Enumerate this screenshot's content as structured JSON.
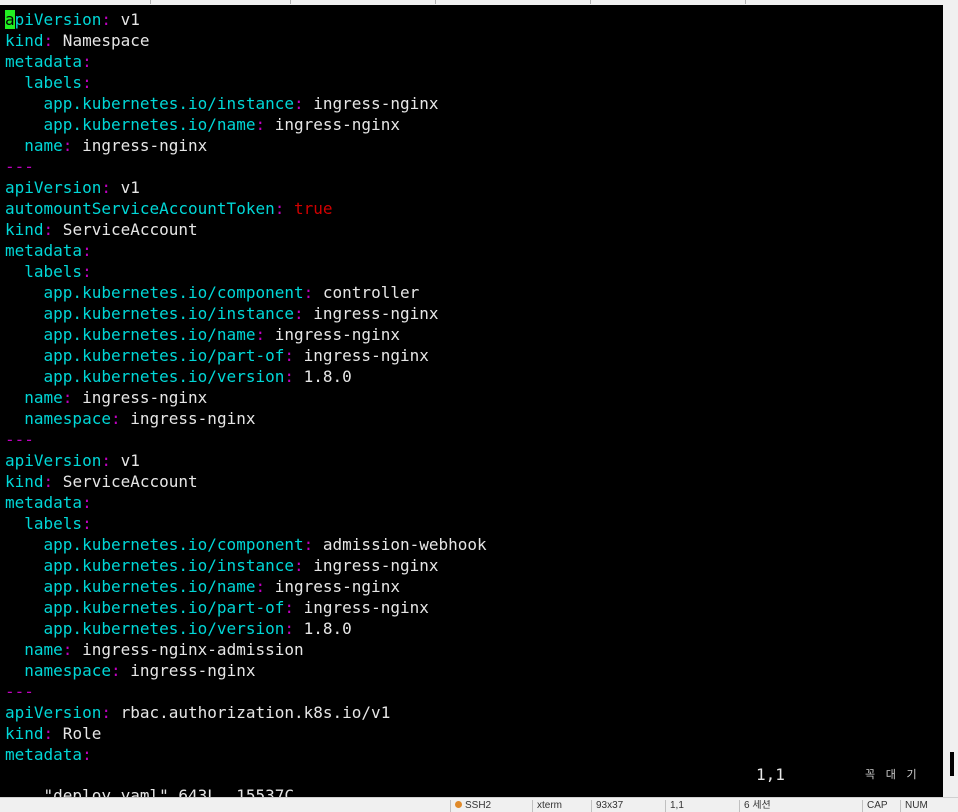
{
  "editor": {
    "lines": [
      [
        {
          "c": "k",
          "t": "apiVersion"
        },
        {
          "c": "c",
          "t": ":"
        },
        {
          "c": "v",
          "t": " v1"
        }
      ],
      [
        {
          "c": "k",
          "t": "kind"
        },
        {
          "c": "c",
          "t": ":"
        },
        {
          "c": "v",
          "t": " Namespace"
        }
      ],
      [
        {
          "c": "k",
          "t": "metadata"
        },
        {
          "c": "c",
          "t": ":"
        }
      ],
      [
        {
          "c": "v",
          "t": "  "
        },
        {
          "c": "k",
          "t": "labels"
        },
        {
          "c": "c",
          "t": ":"
        }
      ],
      [
        {
          "c": "v",
          "t": "    "
        },
        {
          "c": "k",
          "t": "app.kubernetes.io/instance"
        },
        {
          "c": "c",
          "t": ":"
        },
        {
          "c": "v",
          "t": " ingress-nginx"
        }
      ],
      [
        {
          "c": "v",
          "t": "    "
        },
        {
          "c": "k",
          "t": "app.kubernetes.io/name"
        },
        {
          "c": "c",
          "t": ":"
        },
        {
          "c": "v",
          "t": " ingress-nginx"
        }
      ],
      [
        {
          "c": "v",
          "t": "  "
        },
        {
          "c": "k",
          "t": "name"
        },
        {
          "c": "c",
          "t": ":"
        },
        {
          "c": "v",
          "t": " ingress-nginx"
        }
      ],
      [
        {
          "c": "c",
          "t": "---"
        }
      ],
      [
        {
          "c": "k",
          "t": "apiVersion"
        },
        {
          "c": "c",
          "t": ":"
        },
        {
          "c": "v",
          "t": " v1"
        }
      ],
      [
        {
          "c": "k",
          "t": "automountServiceAccountToken"
        },
        {
          "c": "c",
          "t": ":"
        },
        {
          "c": "t",
          "t": " true"
        }
      ],
      [
        {
          "c": "k",
          "t": "kind"
        },
        {
          "c": "c",
          "t": ":"
        },
        {
          "c": "v",
          "t": " ServiceAccount"
        }
      ],
      [
        {
          "c": "k",
          "t": "metadata"
        },
        {
          "c": "c",
          "t": ":"
        }
      ],
      [
        {
          "c": "v",
          "t": "  "
        },
        {
          "c": "k",
          "t": "labels"
        },
        {
          "c": "c",
          "t": ":"
        }
      ],
      [
        {
          "c": "v",
          "t": "    "
        },
        {
          "c": "k",
          "t": "app.kubernetes.io/component"
        },
        {
          "c": "c",
          "t": ":"
        },
        {
          "c": "v",
          "t": " controller"
        }
      ],
      [
        {
          "c": "v",
          "t": "    "
        },
        {
          "c": "k",
          "t": "app.kubernetes.io/instance"
        },
        {
          "c": "c",
          "t": ":"
        },
        {
          "c": "v",
          "t": " ingress-nginx"
        }
      ],
      [
        {
          "c": "v",
          "t": "    "
        },
        {
          "c": "k",
          "t": "app.kubernetes.io/name"
        },
        {
          "c": "c",
          "t": ":"
        },
        {
          "c": "v",
          "t": " ingress-nginx"
        }
      ],
      [
        {
          "c": "v",
          "t": "    "
        },
        {
          "c": "k",
          "t": "app.kubernetes.io/part-of"
        },
        {
          "c": "c",
          "t": ":"
        },
        {
          "c": "v",
          "t": " ingress-nginx"
        }
      ],
      [
        {
          "c": "v",
          "t": "    "
        },
        {
          "c": "k",
          "t": "app.kubernetes.io/version"
        },
        {
          "c": "c",
          "t": ":"
        },
        {
          "c": "v",
          "t": " 1.8.0"
        }
      ],
      [
        {
          "c": "v",
          "t": "  "
        },
        {
          "c": "k",
          "t": "name"
        },
        {
          "c": "c",
          "t": ":"
        },
        {
          "c": "v",
          "t": " ingress-nginx"
        }
      ],
      [
        {
          "c": "v",
          "t": "  "
        },
        {
          "c": "k",
          "t": "namespace"
        },
        {
          "c": "c",
          "t": ":"
        },
        {
          "c": "v",
          "t": " ingress-nginx"
        }
      ],
      [
        {
          "c": "c",
          "t": "---"
        }
      ],
      [
        {
          "c": "k",
          "t": "apiVersion"
        },
        {
          "c": "c",
          "t": ":"
        },
        {
          "c": "v",
          "t": " v1"
        }
      ],
      [
        {
          "c": "k",
          "t": "kind"
        },
        {
          "c": "c",
          "t": ":"
        },
        {
          "c": "v",
          "t": " ServiceAccount"
        }
      ],
      [
        {
          "c": "k",
          "t": "metadata"
        },
        {
          "c": "c",
          "t": ":"
        }
      ],
      [
        {
          "c": "v",
          "t": "  "
        },
        {
          "c": "k",
          "t": "labels"
        },
        {
          "c": "c",
          "t": ":"
        }
      ],
      [
        {
          "c": "v",
          "t": "    "
        },
        {
          "c": "k",
          "t": "app.kubernetes.io/component"
        },
        {
          "c": "c",
          "t": ":"
        },
        {
          "c": "v",
          "t": " admission-webhook"
        }
      ],
      [
        {
          "c": "v",
          "t": "    "
        },
        {
          "c": "k",
          "t": "app.kubernetes.io/instance"
        },
        {
          "c": "c",
          "t": ":"
        },
        {
          "c": "v",
          "t": " ingress-nginx"
        }
      ],
      [
        {
          "c": "v",
          "t": "    "
        },
        {
          "c": "k",
          "t": "app.kubernetes.io/name"
        },
        {
          "c": "c",
          "t": ":"
        },
        {
          "c": "v",
          "t": " ingress-nginx"
        }
      ],
      [
        {
          "c": "v",
          "t": "    "
        },
        {
          "c": "k",
          "t": "app.kubernetes.io/part-of"
        },
        {
          "c": "c",
          "t": ":"
        },
        {
          "c": "v",
          "t": " ingress-nginx"
        }
      ],
      [
        {
          "c": "v",
          "t": "    "
        },
        {
          "c": "k",
          "t": "app.kubernetes.io/version"
        },
        {
          "c": "c",
          "t": ":"
        },
        {
          "c": "v",
          "t": " 1.8.0"
        }
      ],
      [
        {
          "c": "v",
          "t": "  "
        },
        {
          "c": "k",
          "t": "name"
        },
        {
          "c": "c",
          "t": ":"
        },
        {
          "c": "v",
          "t": " ingress-nginx-admission"
        }
      ],
      [
        {
          "c": "v",
          "t": "  "
        },
        {
          "c": "k",
          "t": "namespace"
        },
        {
          "c": "c",
          "t": ":"
        },
        {
          "c": "v",
          "t": " ingress-nginx"
        }
      ],
      [
        {
          "c": "c",
          "t": "---"
        }
      ],
      [
        {
          "c": "k",
          "t": "apiVersion"
        },
        {
          "c": "c",
          "t": ":"
        },
        {
          "c": "v",
          "t": " rbac.authorization.k8s.io/v1"
        }
      ],
      [
        {
          "c": "k",
          "t": "kind"
        },
        {
          "c": "c",
          "t": ":"
        },
        {
          "c": "v",
          "t": " Role"
        }
      ],
      [
        {
          "c": "k",
          "t": "metadata"
        },
        {
          "c": "c",
          "t": ":"
        }
      ]
    ],
    "status_line": "\"deploy.yaml\" 643L, 15537C",
    "cursor_pos": "1,1",
    "ime_indicator": "꼭 대 기"
  },
  "colors": {
    "background": "#000000",
    "key": "#00d7d7",
    "punct": "#c000c0",
    "value": "#e6e6e6",
    "boolean": "#d00000",
    "cursor": "#22ee22"
  },
  "statusbar": {
    "items": [
      "SSH2",
      "xterm",
      "93x37",
      "1,1",
      "6 세션",
      "CAP",
      "NUM"
    ]
  }
}
